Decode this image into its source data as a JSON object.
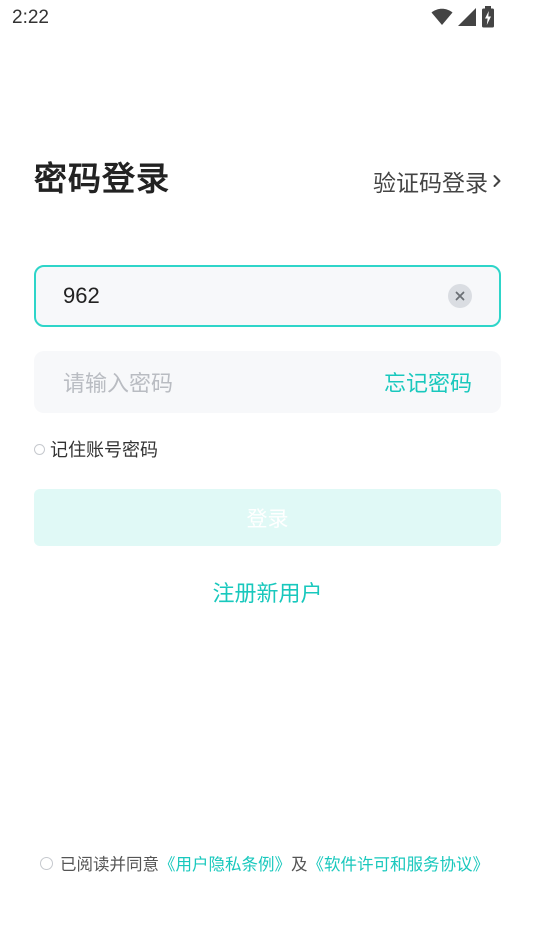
{
  "status_bar": {
    "time": "2:22",
    "icons": [
      "wifi-icon",
      "cellular-signal-icon",
      "battery-charging-icon"
    ]
  },
  "header": {
    "title": "密码登录",
    "switch_label": "验证码登录",
    "switch_icon": "chevron-right-icon"
  },
  "form": {
    "account": {
      "value": "962",
      "clear_icon": "clear-icon"
    },
    "password": {
      "placeholder": "请输入密码",
      "value": "",
      "forgot_label": "忘记密码"
    },
    "remember_label": "记住账号密码",
    "remember_checked": false,
    "login_label": "登录",
    "register_label": "注册新用户"
  },
  "agreement": {
    "checked": false,
    "prefix": "已阅读并同意",
    "privacy_link": "《用户隐私条例》",
    "connector": "及",
    "license_link": "《软件许可和服务协议》"
  },
  "colors": {
    "accent": "#19c8bd",
    "input_border_active": "#2ed5c9",
    "input_bg": "#f7f8fa",
    "button_disabled_bg": "#e0f9f6",
    "placeholder": "#b9bcc2"
  }
}
